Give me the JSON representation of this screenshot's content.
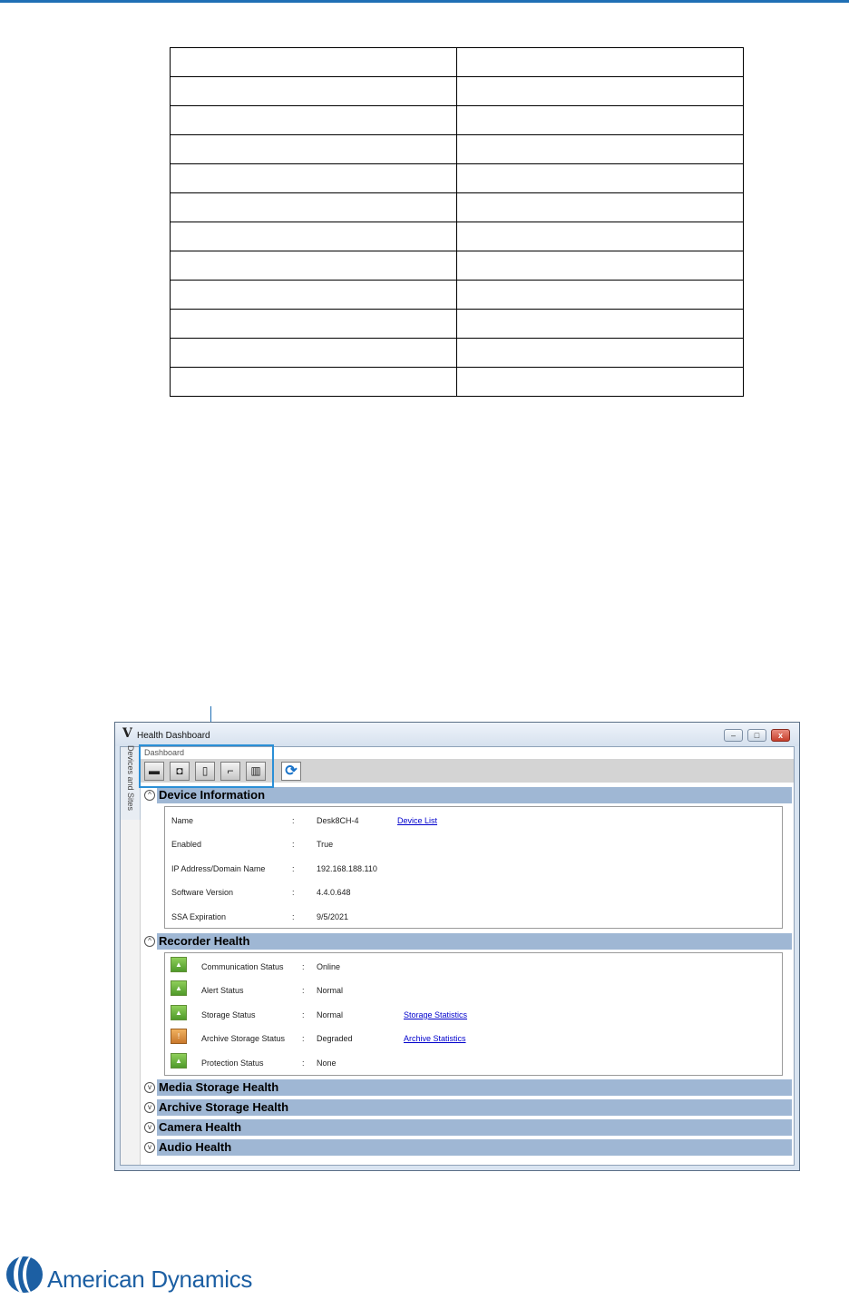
{
  "window": {
    "title": "Health Dashboard",
    "side_tab": "Devices and Sites",
    "dashboard_label": "Dashboard",
    "buttons": {
      "minimize": "–",
      "maximize": "□",
      "close": "x"
    }
  },
  "toolbar": {
    "icons": [
      "recorder-icon",
      "door-lock-icon",
      "door-icon",
      "camera-icon",
      "archive-icon",
      "refresh-icon"
    ]
  },
  "device_information": {
    "title": "Device Information",
    "rows": [
      {
        "label": "Name",
        "sep": ":",
        "value": "Desk8CH-4",
        "link": "Device List"
      },
      {
        "label": "Enabled",
        "sep": ":",
        "value": "True"
      },
      {
        "label": "IP Address/Domain Name",
        "sep": ":",
        "value": "192.168.188.110"
      },
      {
        "label": "Software Version",
        "sep": ":",
        "value": "4.4.0.648"
      },
      {
        "label": "SSA Expiration",
        "sep": ":",
        "value": "9/5/2021"
      }
    ]
  },
  "recorder_health": {
    "title": "Recorder Health",
    "rows": [
      {
        "label": "Communication Status",
        "sep": ":",
        "value": "Online",
        "state": "ok"
      },
      {
        "label": "Alert Status",
        "sep": ":",
        "value": "Normal",
        "state": "ok"
      },
      {
        "label": "Storage Status",
        "sep": ":",
        "value": "Normal",
        "state": "ok",
        "link": "Storage Statistics"
      },
      {
        "label": "Archive Storage Status",
        "sep": ":",
        "value": "Degraded",
        "state": "degraded",
        "link": "Archive Statistics"
      },
      {
        "label": "Protection Status",
        "sep": ":",
        "value": "None",
        "state": "ok"
      }
    ]
  },
  "collapsed_sections": [
    "Media Storage Health",
    "Archive Storage Health",
    "Camera Health",
    "Audio Health"
  ],
  "colors": {
    "accent": "#1f6fb5",
    "section_bar": "#9fb7d4",
    "ok": "#6fb640",
    "degraded": "#e09a45"
  },
  "footer": {
    "brand": "American Dynamics"
  }
}
